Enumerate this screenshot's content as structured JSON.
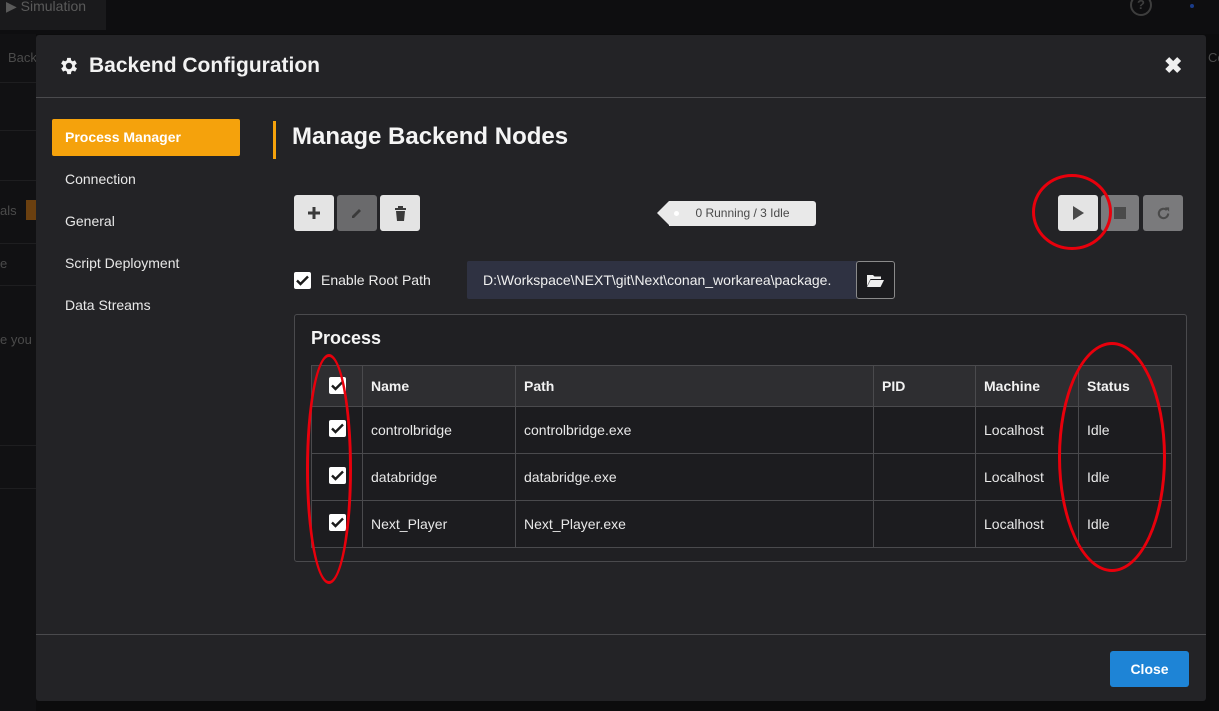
{
  "background": {
    "tab_label": "Simulation",
    "help_glyph": "?",
    "side_texts": [
      "Back",
      "als",
      "e",
      "e you l"
    ],
    "right_edge_text": "Co"
  },
  "modal": {
    "title": "Backend Configuration",
    "close_glyph": "✖",
    "nav": [
      {
        "label": "Process Manager",
        "active": true
      },
      {
        "label": "Connection",
        "active": false
      },
      {
        "label": "General",
        "active": false
      },
      {
        "label": "Script Deployment",
        "active": false
      },
      {
        "label": "Data Streams",
        "active": false
      }
    ],
    "heading": "Manage Backend Nodes",
    "toolbar": {
      "add_icon": "plus-icon",
      "edit_icon": "pencil-icon",
      "delete_icon": "trash-icon",
      "status": "0 Running / 3 Idle",
      "play_icon": "play-icon",
      "stop_icon": "stop-icon",
      "restart_icon": "refresh-icon"
    },
    "root_path": {
      "label": "Enable Root Path",
      "checked": true,
      "value": "D:\\Workspace\\NEXT\\git\\Next\\conan_workarea\\package.",
      "browse_icon": "folder-open-icon"
    },
    "process": {
      "title": "Process",
      "columns": [
        "Name",
        "Path",
        "PID",
        "Machine",
        "Status"
      ],
      "select_all": true,
      "rows": [
        {
          "checked": true,
          "name": "controlbridge",
          "path": "controlbridge.exe",
          "pid": "",
          "machine": "Localhost",
          "status": "Idle"
        },
        {
          "checked": true,
          "name": "databridge",
          "path": "databridge.exe",
          "pid": "",
          "machine": "Localhost",
          "status": "Idle"
        },
        {
          "checked": true,
          "name": "Next_Player",
          "path": "Next_Player.exe",
          "pid": "",
          "machine": "Localhost",
          "status": "Idle"
        }
      ]
    },
    "footer": {
      "close_label": "Close"
    }
  },
  "colors": {
    "accent": "#f5a20c",
    "primary_button": "#1e84d6",
    "annotation": "#e8000c"
  }
}
